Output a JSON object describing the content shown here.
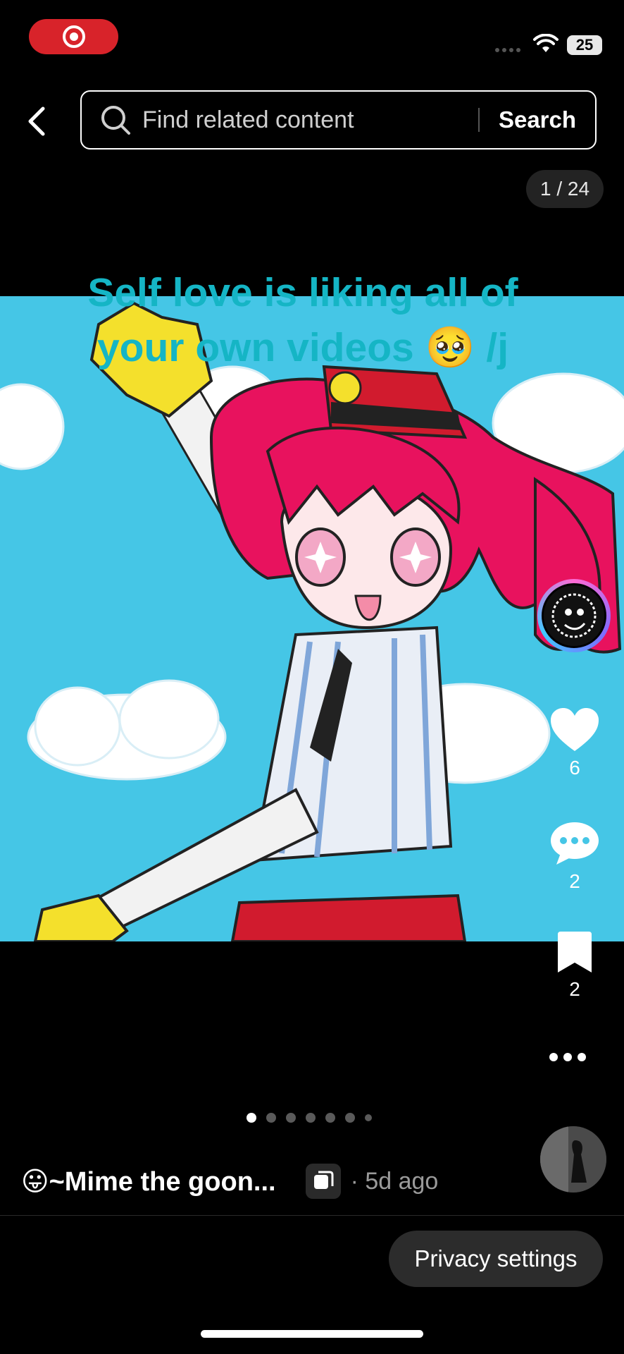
{
  "status_bar": {
    "battery": "25"
  },
  "search": {
    "placeholder": "Find related content",
    "button_label": "Search"
  },
  "media": {
    "page_counter": "1 / 24",
    "overlay_caption": "Self love is liking all of your own videos 🥹 /j",
    "total_pages": 24,
    "current_page": 1
  },
  "actions": {
    "likes": "6",
    "comments": "2",
    "saves": "2"
  },
  "post": {
    "username": "😛~Mime the goon...",
    "time": "· 5d ago"
  },
  "footer": {
    "privacy_label": "Privacy settings"
  },
  "colors": {
    "record_red": "#d8232a",
    "caption_cyan": "#15b5c5",
    "sky_blue": "#45c6e6",
    "hair_pink": "#e8125e"
  },
  "icons": [
    "record-icon",
    "wifi-icon",
    "back-icon",
    "search-icon",
    "heart-icon",
    "comment-icon",
    "bookmark-icon",
    "more-icon",
    "repost-icon"
  ]
}
